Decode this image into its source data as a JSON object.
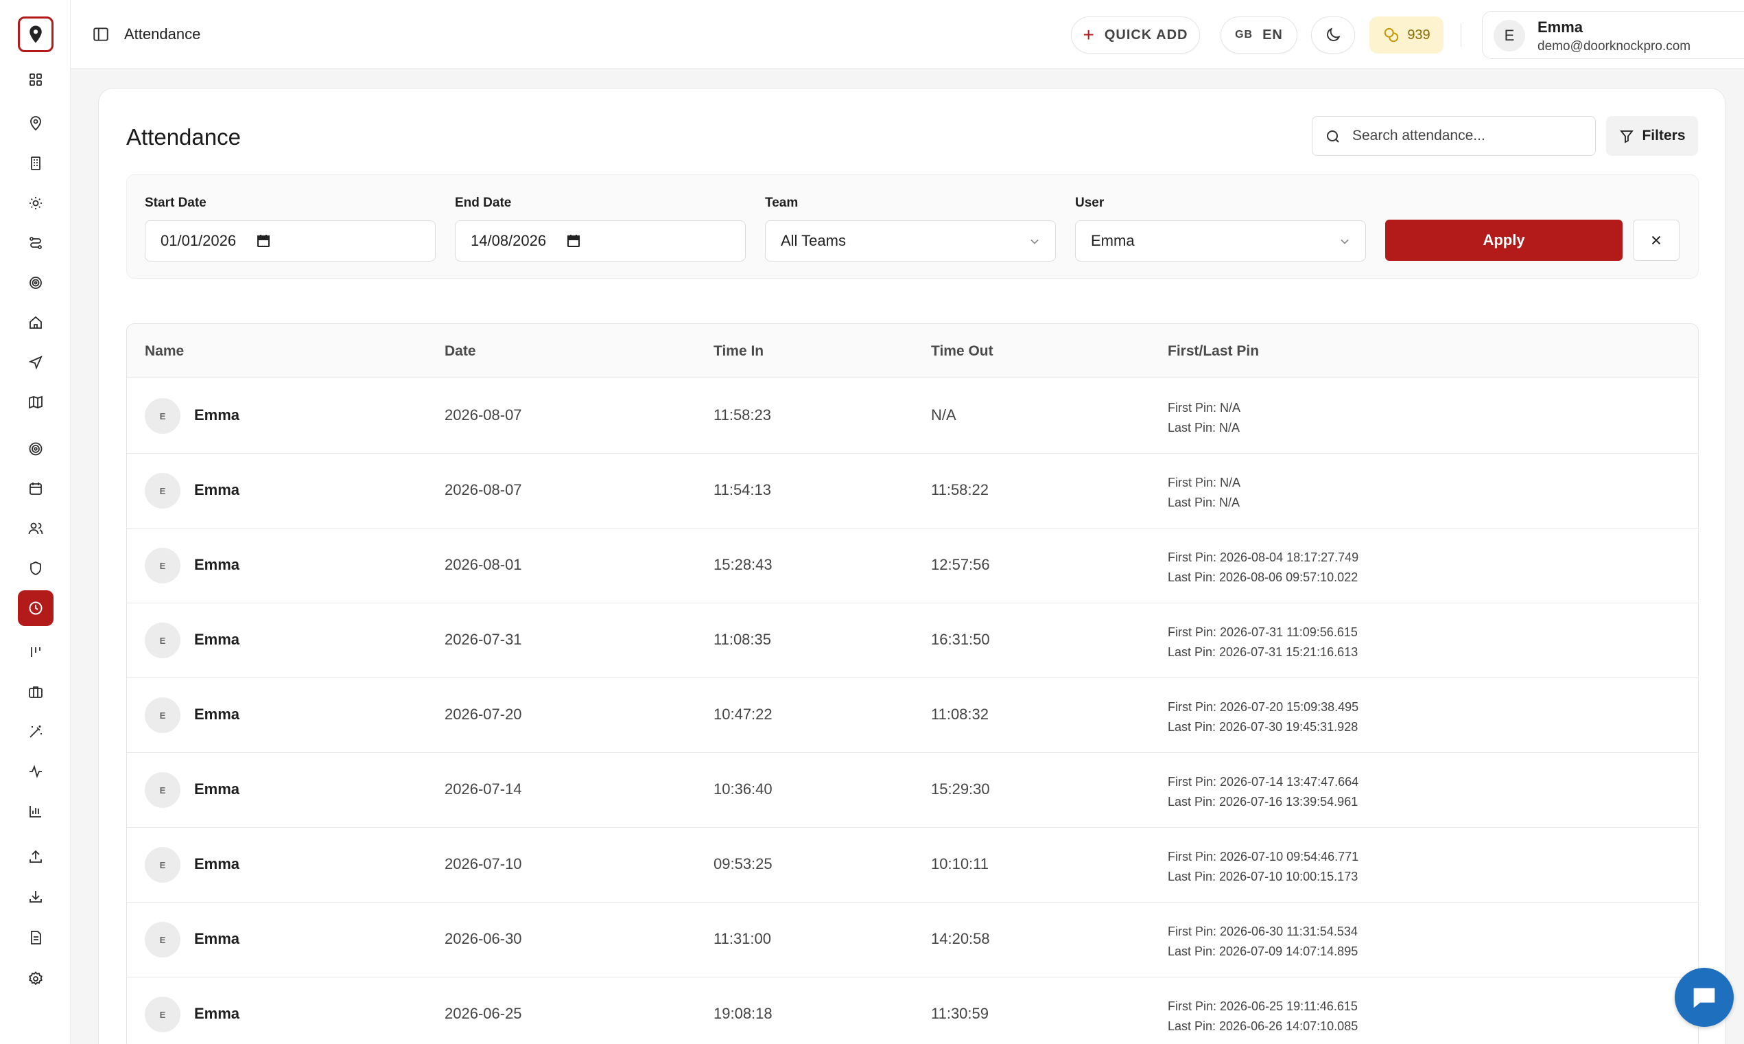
{
  "header": {
    "breadcrumb": "Attendance",
    "quick_add_label": "QUICK ADD",
    "lang_flag": "GB",
    "lang_code": "EN",
    "credits": "939",
    "user": {
      "initial": "E",
      "name": "Emma",
      "email": "demo@doorknockpro.com"
    }
  },
  "sidebar": {
    "active_color": "#b31b1b",
    "icons": [
      "map-pin-logo-icon",
      "dashboard-grid-icon",
      "location-pin-icon",
      "building-icon",
      "sun-icon",
      "route-icon",
      "target-spiral-icon",
      "home-icon",
      "navigation-icon",
      "map-icon",
      "target-icon",
      "calendar-icon",
      "users-icon",
      "shield-icon",
      "clock-icon",
      "kanban-icon",
      "briefcase-icon",
      "magic-wand-icon",
      "activity-icon",
      "bar-chart-icon",
      "upload-icon",
      "download-icon",
      "document-icon",
      "settings-icon"
    ]
  },
  "page": {
    "title": "Attendance",
    "search_placeholder": "Search attendance...",
    "filters_label": "Filters"
  },
  "filters": {
    "start_date_label": "Start Date",
    "start_date_value": "01/01/2026",
    "end_date_label": "End Date",
    "end_date_value": "14/08/2026",
    "team_label": "Team",
    "team_value": "All Teams",
    "user_label": "User",
    "user_value": "Emma",
    "apply_label": "Apply"
  },
  "table": {
    "columns": [
      "Name",
      "Date",
      "Time In",
      "Time Out",
      "First/Last Pin"
    ],
    "rows": [
      {
        "initial": "E",
        "name": "Emma",
        "date": "2026-08-07",
        "time_in": "11:58:23",
        "time_out": "N/A",
        "first_pin": "First Pin: N/A",
        "last_pin": "Last Pin: N/A"
      },
      {
        "initial": "E",
        "name": "Emma",
        "date": "2026-08-07",
        "time_in": "11:54:13",
        "time_out": "11:58:22",
        "first_pin": "First Pin: N/A",
        "last_pin": "Last Pin: N/A"
      },
      {
        "initial": "E",
        "name": "Emma",
        "date": "2026-08-01",
        "time_in": "15:28:43",
        "time_out": "12:57:56",
        "first_pin": "First Pin: 2026-08-04 18:17:27.749",
        "last_pin": "Last Pin: 2026-08-06 09:57:10.022"
      },
      {
        "initial": "E",
        "name": "Emma",
        "date": "2026-07-31",
        "time_in": "11:08:35",
        "time_out": "16:31:50",
        "first_pin": "First Pin: 2026-07-31 11:09:56.615",
        "last_pin": "Last Pin: 2026-07-31 15:21:16.613"
      },
      {
        "initial": "E",
        "name": "Emma",
        "date": "2026-07-20",
        "time_in": "10:47:22",
        "time_out": "11:08:32",
        "first_pin": "First Pin: 2026-07-20 15:09:38.495",
        "last_pin": "Last Pin: 2026-07-30 19:45:31.928"
      },
      {
        "initial": "E",
        "name": "Emma",
        "date": "2026-07-14",
        "time_in": "10:36:40",
        "time_out": "15:29:30",
        "first_pin": "First Pin: 2026-07-14 13:47:47.664",
        "last_pin": "Last Pin: 2026-07-16 13:39:54.961"
      },
      {
        "initial": "E",
        "name": "Emma",
        "date": "2026-07-10",
        "time_in": "09:53:25",
        "time_out": "10:10:11",
        "first_pin": "First Pin: 2026-07-10 09:54:46.771",
        "last_pin": "Last Pin: 2026-07-10 10:00:15.173"
      },
      {
        "initial": "E",
        "name": "Emma",
        "date": "2026-06-30",
        "time_in": "11:31:00",
        "time_out": "14:20:58",
        "first_pin": "First Pin: 2026-06-30 11:31:54.534",
        "last_pin": "Last Pin: 2026-07-09 14:07:14.895"
      },
      {
        "initial": "E",
        "name": "Emma",
        "date": "2026-06-25",
        "time_in": "19:08:18",
        "time_out": "11:30:59",
        "first_pin": "First Pin: 2026-06-25 19:11:46.615",
        "last_pin": "Last Pin: 2026-06-26 14:07:10.085"
      }
    ]
  }
}
